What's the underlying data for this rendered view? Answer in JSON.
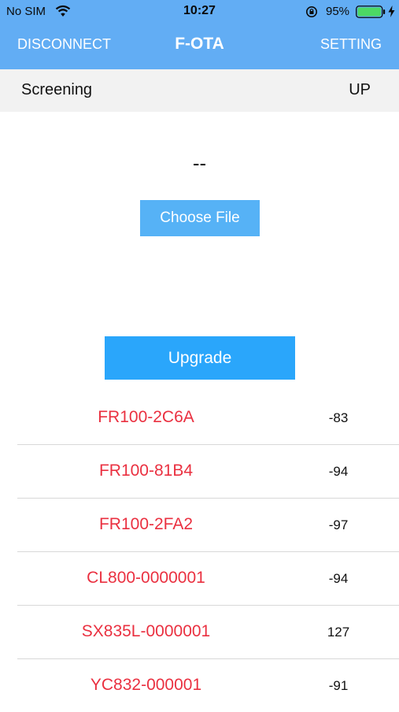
{
  "status_bar": {
    "carrier": "No SIM",
    "time": "10:27",
    "battery_percent": "95%",
    "battery_level": 0.95,
    "wifi_icon": "wifi-icon",
    "orientation_icon": "orientation-lock-icon"
  },
  "nav": {
    "left_label": "DISCONNECT",
    "title": "F-OTA",
    "right_label": "SETTING"
  },
  "sub_bar": {
    "left_label": "Screening",
    "right_label": "UP"
  },
  "main": {
    "file_value": "--",
    "choose_file_label": "Choose File",
    "upgrade_label": "Upgrade"
  },
  "devices": [
    {
      "name": "FR100-2C6A",
      "rssi": "-83"
    },
    {
      "name": "FR100-81B4",
      "rssi": "-94"
    },
    {
      "name": "FR100-2FA2",
      "rssi": "-97"
    },
    {
      "name": "CL800-0000001",
      "rssi": "-94"
    },
    {
      "name": "SX835L-0000001",
      "rssi": "127"
    },
    {
      "name": "YC832-000001",
      "rssi": "-91"
    }
  ],
  "colors": {
    "header_bg": "#62adf4",
    "button_light": "#56b2f6",
    "button_primary": "#2aa6fb",
    "device_name": "#ea3040",
    "battery_fill": "#4cd964"
  }
}
